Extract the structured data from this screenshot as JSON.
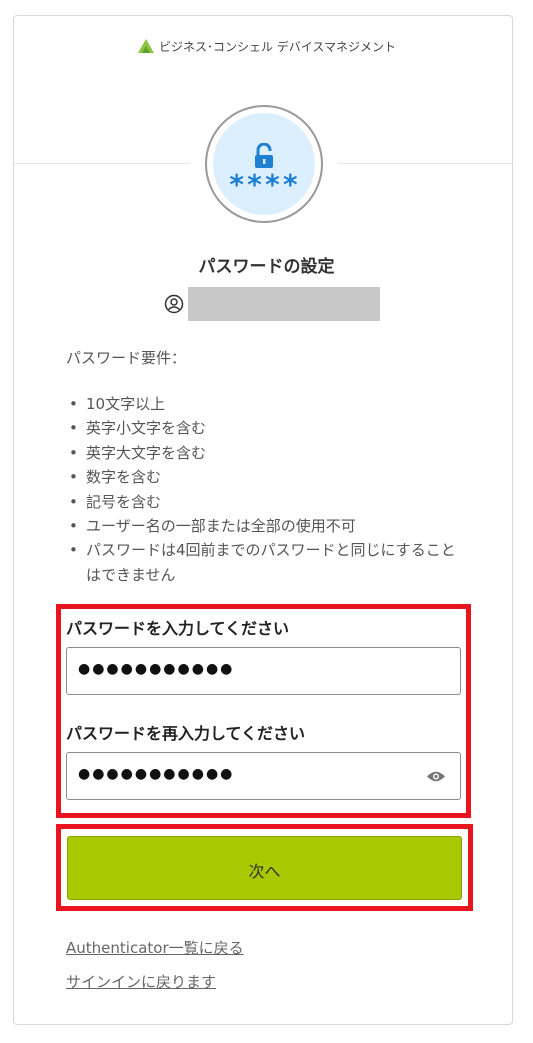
{
  "brand": {
    "name": "ビジネス･コンシェル デバイスマネジメント",
    "logo_icon": "leaf-logo-icon",
    "accent": "#8cc63e"
  },
  "header": {
    "icon": "password-lock-icon",
    "stars": "****",
    "icon_color": "#1f7fd1"
  },
  "title": "パスワードの設定",
  "user": {
    "icon": "user-circle-icon"
  },
  "requirements": {
    "title": "パスワード要件：",
    "items": [
      "10文字以上",
      "英字小文字を含む",
      "英字大文字を含む",
      "数字を含む",
      "記号を含む",
      "ユーザー名の一部または全部の使用不可",
      "パスワードは4回前までのパスワードと同じにすることはできません"
    ]
  },
  "form": {
    "password_label": "パスワードを入力してください",
    "password_value": "●●●●●●●●●●●",
    "confirm_label": "パスワードを再入力してください",
    "confirm_value": "●●●●●●●●●●●",
    "eye_icon": "eye-icon"
  },
  "next_button": {
    "label": "次へ",
    "color": "#a8c800"
  },
  "links": {
    "authenticator": "Authenticator一覧に戻る",
    "signin": "サインインに戻ります"
  },
  "highlight_color": "#e8141e"
}
